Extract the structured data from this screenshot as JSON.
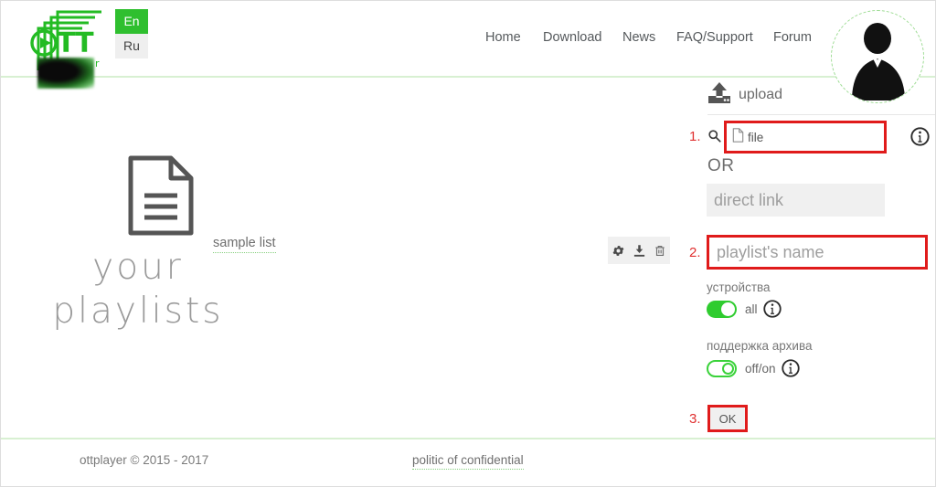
{
  "header": {
    "logo": {
      "name": "OTT",
      "subtitle": "player",
      "color": "#23bb23"
    },
    "language": {
      "active": "En",
      "inactive": "Ru"
    },
    "nav": [
      {
        "label": "Home"
      },
      {
        "label": "Download"
      },
      {
        "label": "News"
      },
      {
        "label": "FAQ/Support"
      },
      {
        "label": "Forum"
      }
    ],
    "avatar_alt": "user avatar"
  },
  "playlists": {
    "empty_line1": "your",
    "empty_line2": "playlists",
    "sample_link": "sample list",
    "actions": [
      {
        "icon": "gear-icon"
      },
      {
        "icon": "download-icon"
      },
      {
        "icon": "trash-icon"
      }
    ]
  },
  "upload": {
    "title": "upload",
    "step1": "1.",
    "step2": "2.",
    "step3": "3.",
    "file_value": "file",
    "or": "OR",
    "direct_link_placeholder": "direct link",
    "direct_link_value": "",
    "playlist_name_placeholder": "playlist's name",
    "playlist_name_value": "",
    "devices_label": "устройства",
    "devices_toggle_text": "all",
    "devices_toggle_state": "on",
    "archive_label": "поддержка архива",
    "archive_toggle_text": "off/on",
    "archive_toggle_state": "off",
    "ok_label": "OK"
  },
  "footer": {
    "copyright": "ottplayer © 2015 - 2017",
    "privacy": "politic of confidential"
  },
  "colors": {
    "brand_green": "#23bb23",
    "toggle_green": "#2fcc2f",
    "highlight_red": "#e01b1b",
    "step_red": "#e03030",
    "divider_green": "#d8f0d2"
  }
}
